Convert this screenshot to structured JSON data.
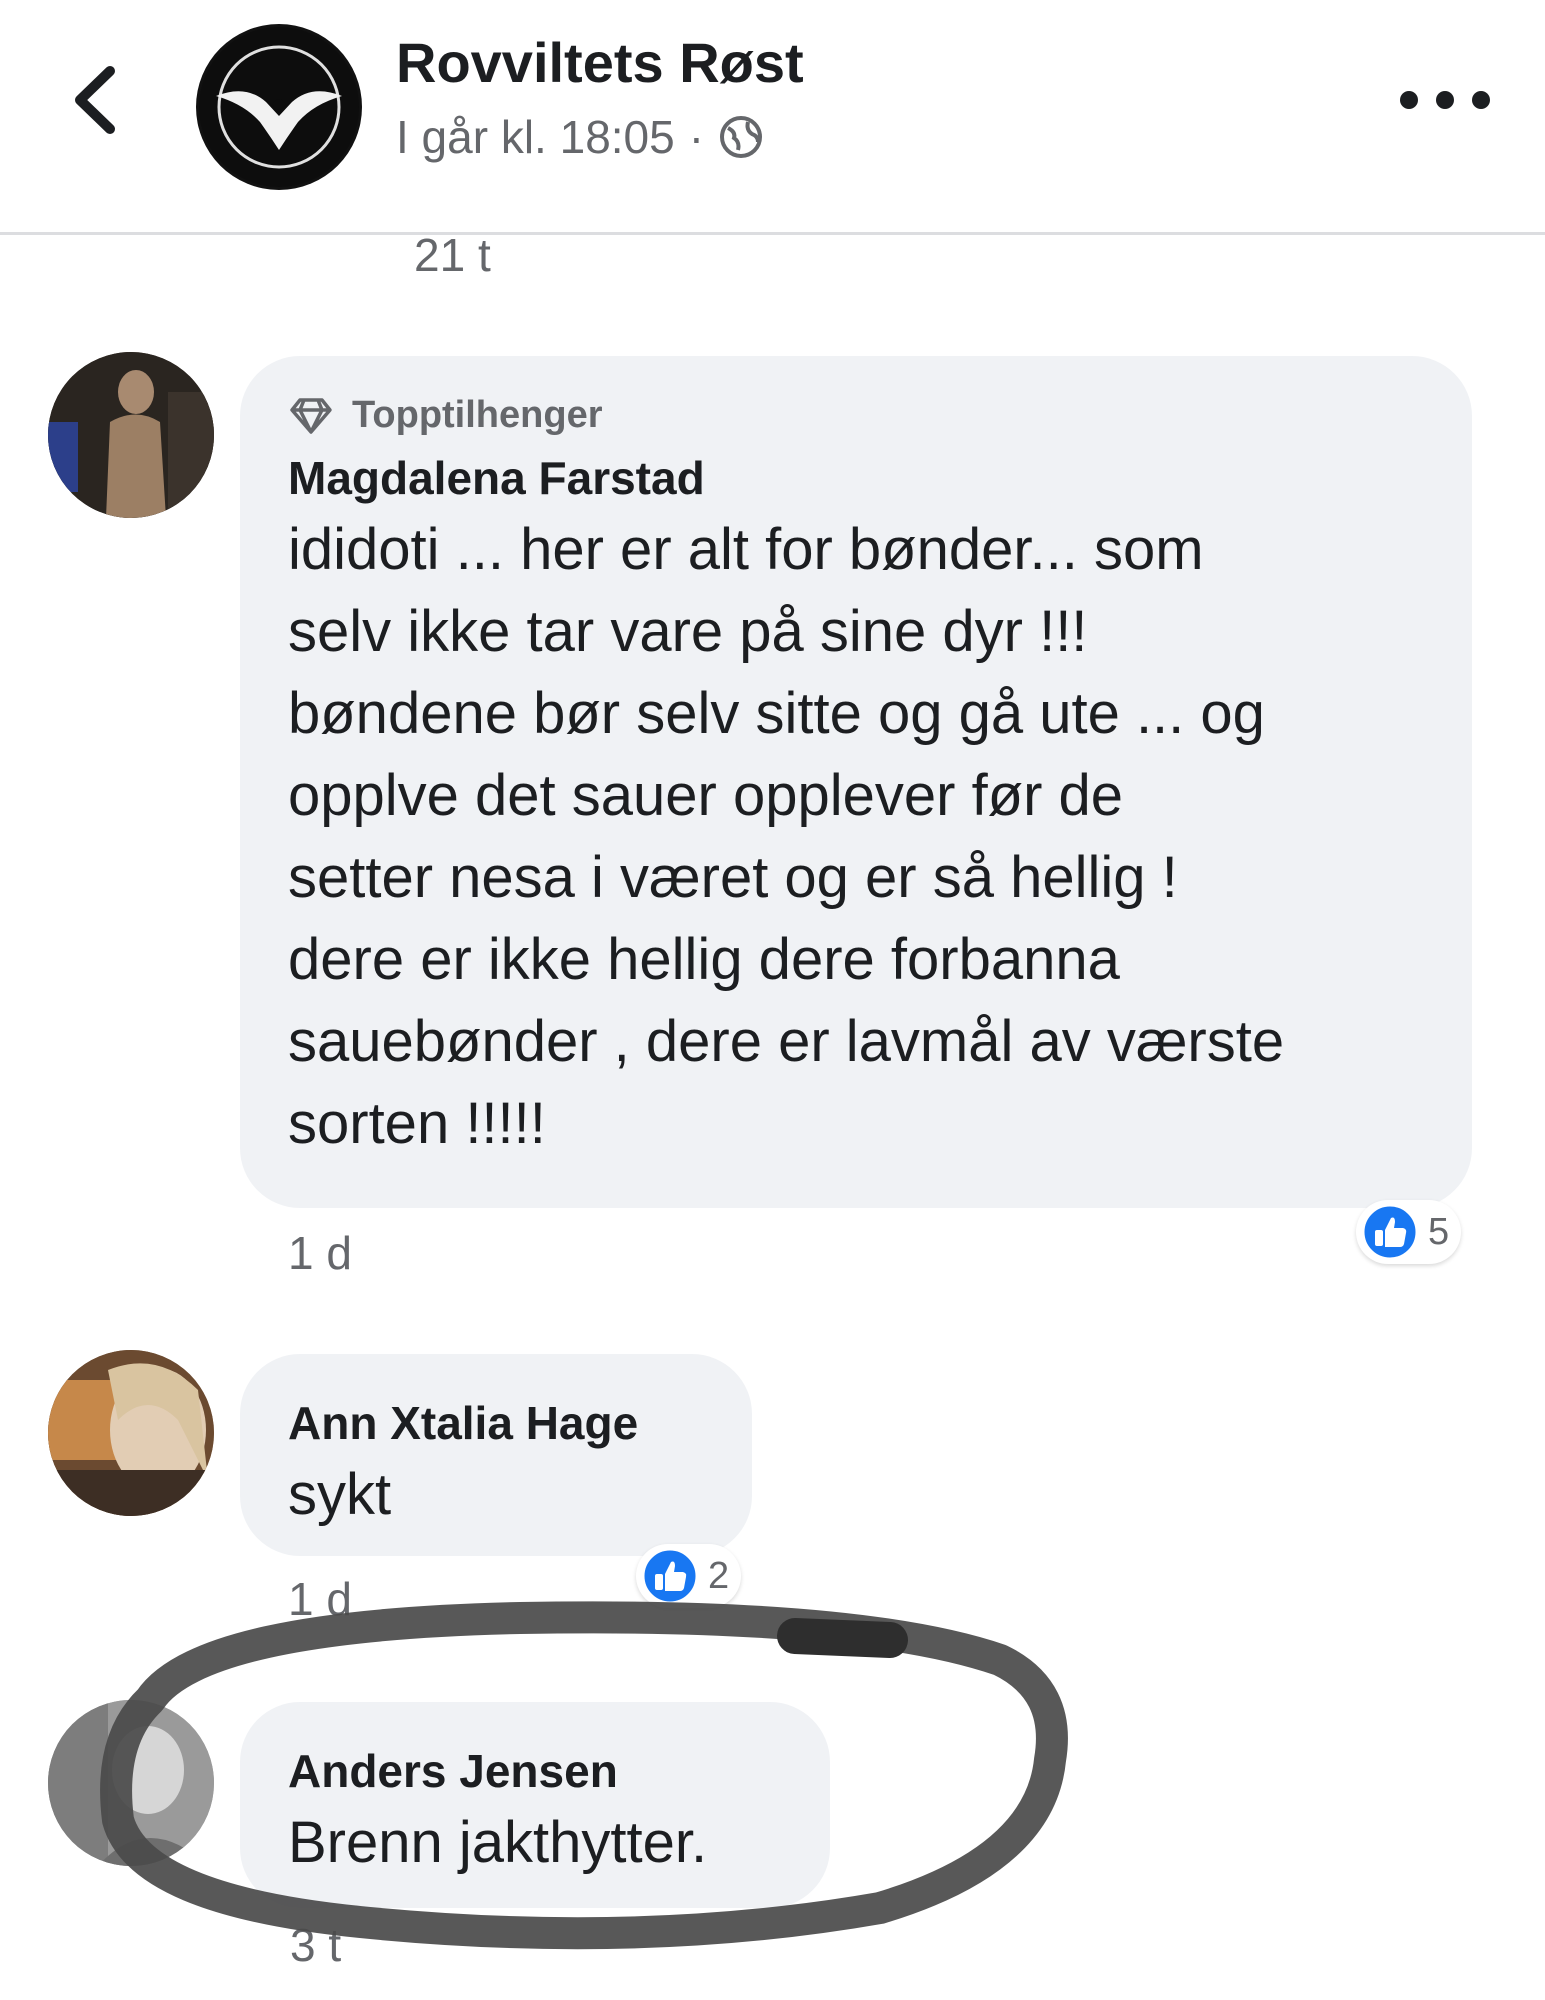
{
  "header": {
    "page_name": "Rovviltets Røst",
    "timestamp": "I går kl. 18:05",
    "separator": "·"
  },
  "previous_comment_time": "21 t",
  "comments": [
    {
      "badge": "Topptilhenger",
      "author": "Magdalena Farstad",
      "text": "ididoti ... her er alt for bønder... som\nselv ikke tar vare på sine dyr !!!\nbøndene bør selv sitte og gå ute ... og\nopplve det sauer opplever før de\nsetter nesa i været og er så hellig !\ndere er ikke hellig dere forbanna\nsauebønder , dere er lavmål av værste\nsorten !!!!!",
      "time": "1 d",
      "likes": "5"
    },
    {
      "author": "Ann Xtalia Hage",
      "text": "sykt",
      "time": "1 d",
      "likes": "2"
    },
    {
      "author": "Anders Jensen",
      "text": "Brenn jakthytter.",
      "time": "3 t"
    }
  ],
  "colors": {
    "like_blue": "#1877f2",
    "bubble_bg": "#f0f2f5",
    "meta_gray": "#65676b",
    "marker": "#4a4a4a"
  },
  "icons": [
    "back-chevron-icon",
    "globe-icon",
    "more-dots-icon",
    "diamond-icon",
    "like-icon"
  ]
}
